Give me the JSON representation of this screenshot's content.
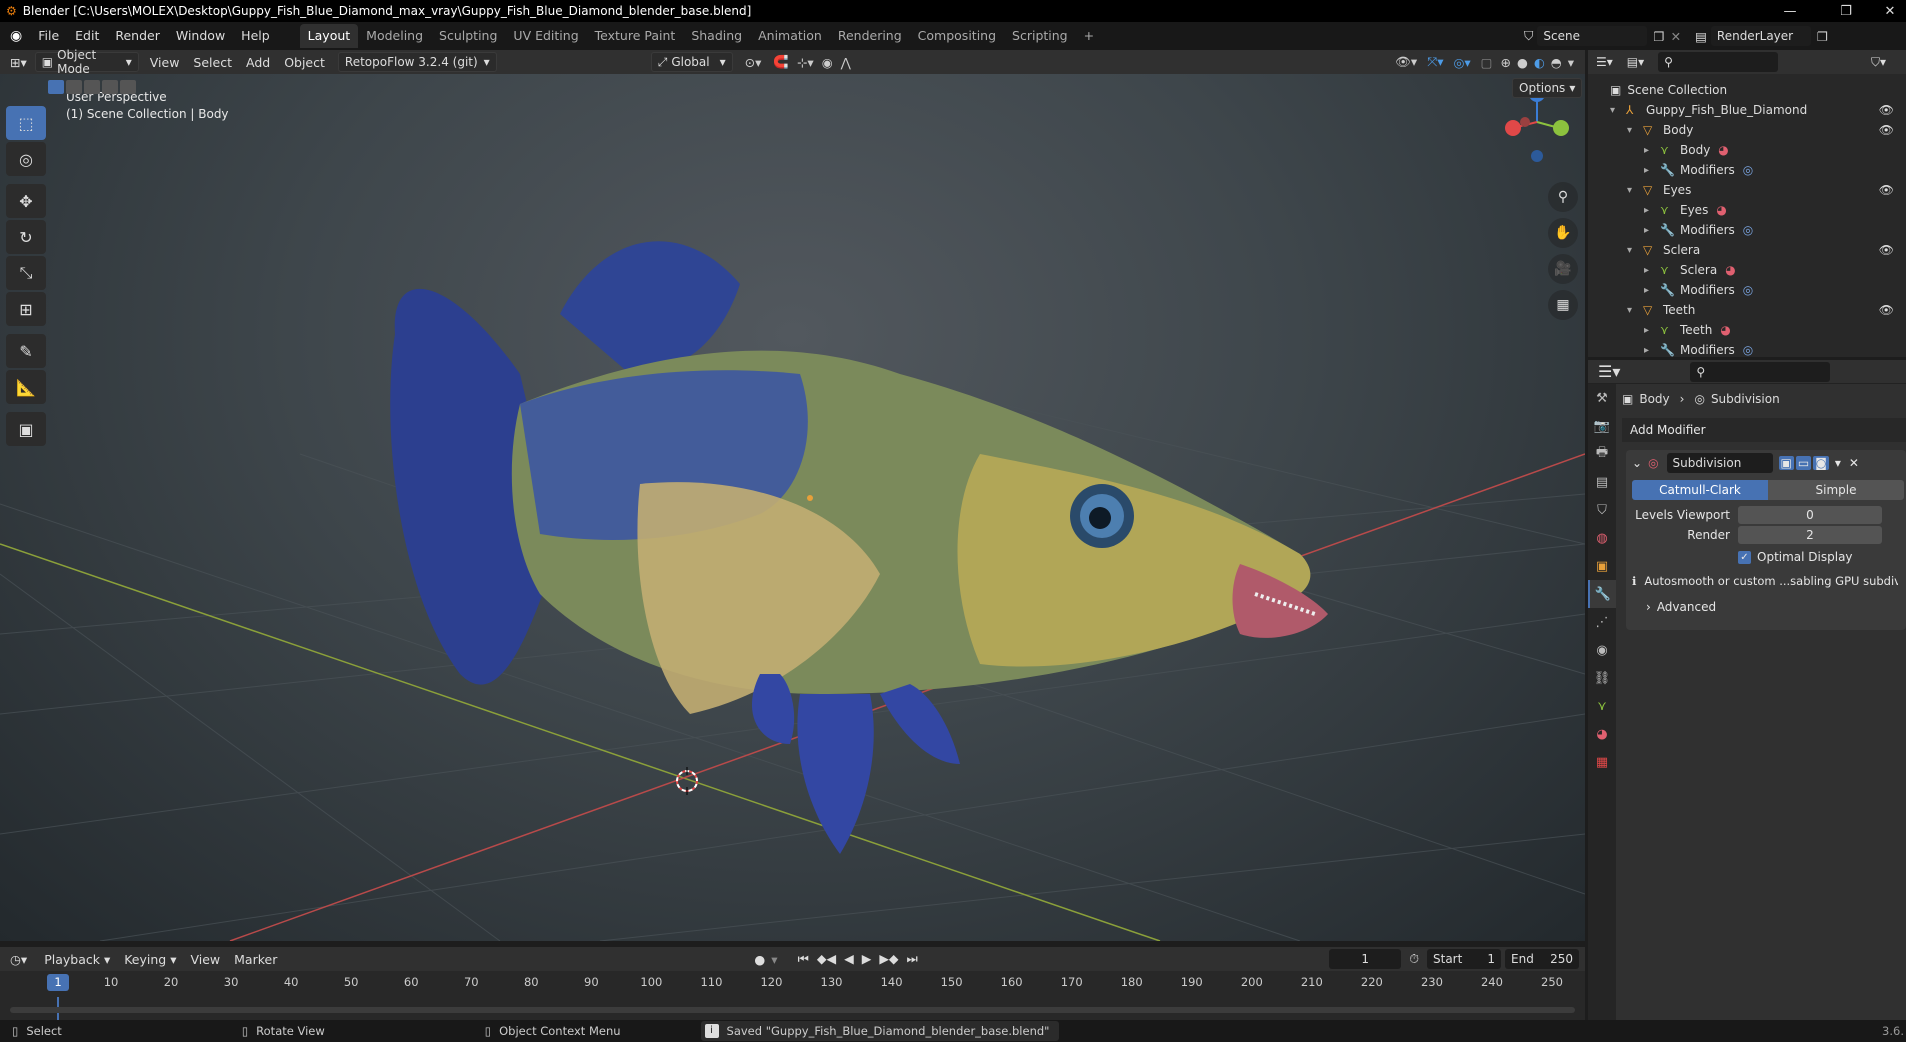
{
  "titlebar": {
    "title": "Blender [C:\\Users\\MOLEX\\Desktop\\Guppy_Fish_Blue_Diamond_max_vray\\Guppy_Fish_Blue_Diamond_blender_base.blend]",
    "minimize": "—",
    "restore": "❐",
    "close": "✕"
  },
  "menubar": {
    "items": [
      "File",
      "Edit",
      "Render",
      "Window",
      "Help"
    ],
    "workspaces": [
      "Layout",
      "Modeling",
      "Sculpting",
      "UV Editing",
      "Texture Paint",
      "Shading",
      "Animation",
      "Rendering",
      "Compositing",
      "Scripting"
    ],
    "add_workspace": "+",
    "scene_name": "Scene",
    "render_layer": "RenderLayer"
  },
  "viewport_header": {
    "mode": "Object Mode",
    "menus": [
      "View",
      "Select",
      "Add",
      "Object"
    ],
    "addon": "RetopoFlow 3.2.4 (git)",
    "transform_orientation": "Global",
    "options": "Options"
  },
  "viewport": {
    "perspective": "User Perspective",
    "collection_info": "(1) Scene Collection | Body",
    "gizmo_z": "Z"
  },
  "outliner": {
    "root": "Scene Collection",
    "rows": [
      {
        "label": "Guppy_Fish_Blue_Diamond",
        "indent": 0,
        "type": "empty"
      },
      {
        "label": "Body",
        "indent": 1,
        "type": "object"
      },
      {
        "label": "Body",
        "indent": 2,
        "type": "mesh"
      },
      {
        "label": "Modifiers",
        "indent": 2,
        "type": "modifier"
      },
      {
        "label": "Eyes",
        "indent": 1,
        "type": "object"
      },
      {
        "label": "Eyes",
        "indent": 2,
        "type": "mesh"
      },
      {
        "label": "Modifiers",
        "indent": 2,
        "type": "modifier"
      },
      {
        "label": "Sclera",
        "indent": 1,
        "type": "object"
      },
      {
        "label": "Sclera",
        "indent": 2,
        "type": "mesh"
      },
      {
        "label": "Modifiers",
        "indent": 2,
        "type": "modifier"
      },
      {
        "label": "Teeth",
        "indent": 1,
        "type": "object"
      },
      {
        "label": "Teeth",
        "indent": 2,
        "type": "mesh"
      },
      {
        "label": "Modifiers",
        "indent": 2,
        "type": "modifier"
      }
    ]
  },
  "properties": {
    "breadcrumb_object": "Body",
    "breadcrumb_modifier": "Subdivision",
    "add_modifier": "Add Modifier",
    "modifier_name": "Subdivision",
    "method_catmull": "Catmull-Clark",
    "method_simple": "Simple",
    "levels_viewport_label": "Levels Viewport",
    "levels_viewport_value": "0",
    "render_label": "Render",
    "render_value": "2",
    "optimal_display": "Optimal Display",
    "info_text": "Autosmooth or custom ...sabling GPU subdivision",
    "advanced": "Advanced"
  },
  "timeline": {
    "menus": [
      "Playback",
      "Keying",
      "View",
      "Marker"
    ],
    "current_frame": "1",
    "start_label": "Start",
    "start_value": "1",
    "end_label": "End",
    "end_value": "250",
    "ticks": [
      "10",
      "20",
      "30",
      "40",
      "50",
      "60",
      "70",
      "80",
      "90",
      "100",
      "110",
      "120",
      "130",
      "140",
      "150",
      "160",
      "170",
      "180",
      "190",
      "200",
      "210",
      "220",
      "230",
      "240",
      "250"
    ],
    "playhead_label": "1"
  },
  "statusbar": {
    "select": "Select",
    "rotate": "Rotate View",
    "context": "Object Context Menu",
    "message": "Saved \"Guppy_Fish_Blue_Diamond_blender_base.blend\"",
    "version": "3.6."
  },
  "colors": {
    "accent": "#4772b3",
    "x_axis": "#e04848",
    "y_axis": "#8cc23e",
    "z_axis": "#3a7dd6"
  }
}
